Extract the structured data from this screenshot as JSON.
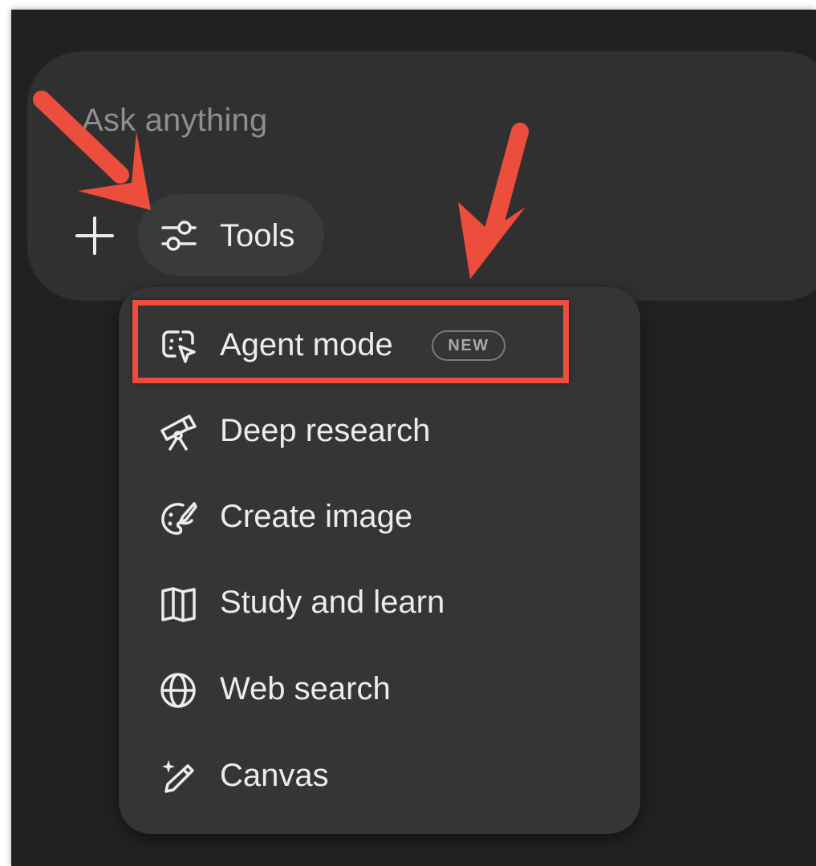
{
  "composer": {
    "placeholder": "Ask anything",
    "plus_icon": "plus-icon",
    "tools": {
      "label": "Tools",
      "icon": "sliders-icon"
    }
  },
  "tools_menu": {
    "items": [
      {
        "label": "Agent mode",
        "icon": "agent-cursor-icon",
        "badge": "NEW",
        "highlighted": true
      },
      {
        "label": "Deep research",
        "icon": "telescope-icon"
      },
      {
        "label": "Create image",
        "icon": "palette-brush-icon"
      },
      {
        "label": "Study and learn",
        "icon": "open-book-icon"
      },
      {
        "label": "Web search",
        "icon": "globe-icon"
      },
      {
        "label": "Canvas",
        "icon": "pencil-sparkle-icon"
      }
    ]
  },
  "annotations": {
    "arrow_color": "#ec4d3d",
    "highlight_color": "#ec4d3d"
  }
}
